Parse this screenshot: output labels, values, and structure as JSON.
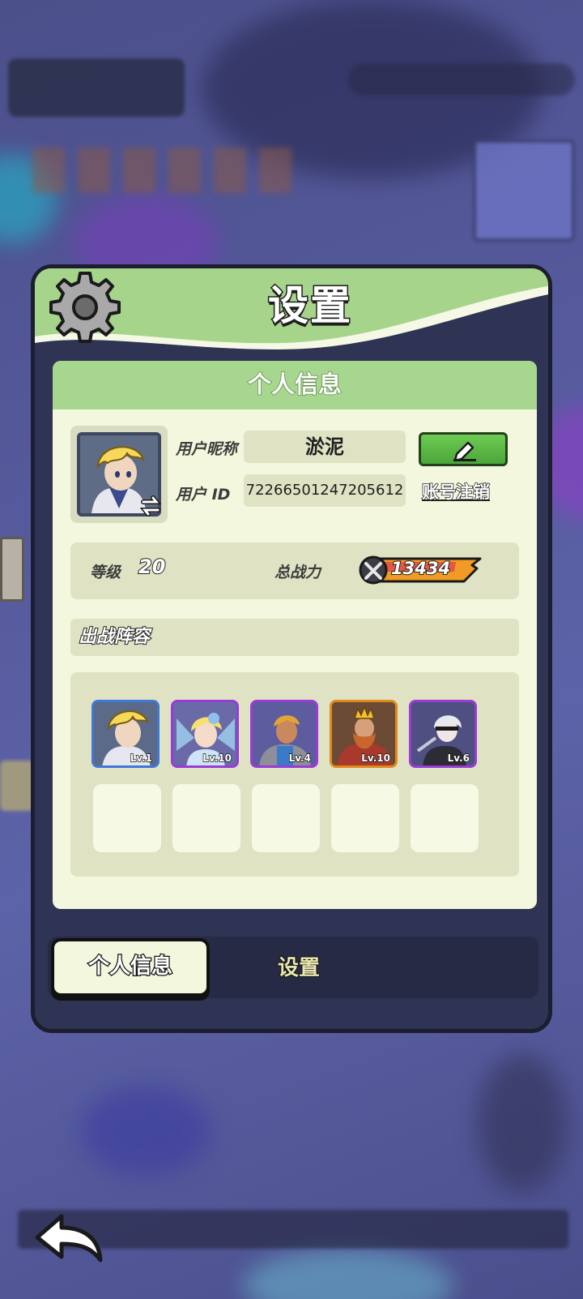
{
  "panel": {
    "title": "设置"
  },
  "profile_section": {
    "header": "个人信息",
    "nickname_label": "用户昵称",
    "nickname_value": "淤泥",
    "id_label": "用户  ID",
    "id_value": "72266501247205612",
    "logout_label": "账号注销"
  },
  "stats": {
    "level_label": "等级",
    "level_value": "20",
    "power_label": "总战力",
    "power_value": "13434"
  },
  "lineup": {
    "title": "出战阵容",
    "heroes": [
      {
        "level": "Lv.1",
        "rarity_color": "#3f78d8"
      },
      {
        "level": "Lv.10",
        "rarity_color": "#9a3bd6"
      },
      {
        "level": "Lv.4",
        "rarity_color": "#9a3bd6"
      },
      {
        "level": "Lv.10",
        "rarity_color": "#e08a1c"
      },
      {
        "level": "Lv.6",
        "rarity_color": "#9a3bd6"
      }
    ]
  },
  "tabs": {
    "profile": "个人信息",
    "settings": "设置"
  },
  "colors": {
    "header_green": "#9fcf7d",
    "card_bg": "#f3f7dd",
    "edit_button": "#5cbb48",
    "panel_dark": "#2f3354"
  }
}
